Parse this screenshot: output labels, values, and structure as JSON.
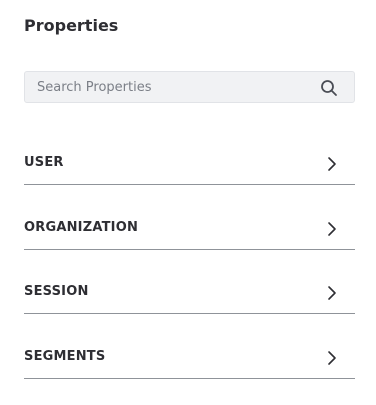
{
  "panel": {
    "title": "Properties"
  },
  "search": {
    "placeholder": "Search Properties",
    "value": "",
    "icon": "search-icon"
  },
  "sections": [
    {
      "label": "USER",
      "icon": "chevron-right-icon"
    },
    {
      "label": "ORGANIZATION",
      "icon": "chevron-right-icon"
    },
    {
      "label": "SESSION",
      "icon": "chevron-right-icon"
    },
    {
      "label": "SEGMENTS",
      "icon": "chevron-right-icon"
    }
  ],
  "colors": {
    "text": "#2e2e33",
    "search_bg": "#f1f2f4",
    "divider": "#8f9399",
    "placeholder": "#7b7f87"
  }
}
